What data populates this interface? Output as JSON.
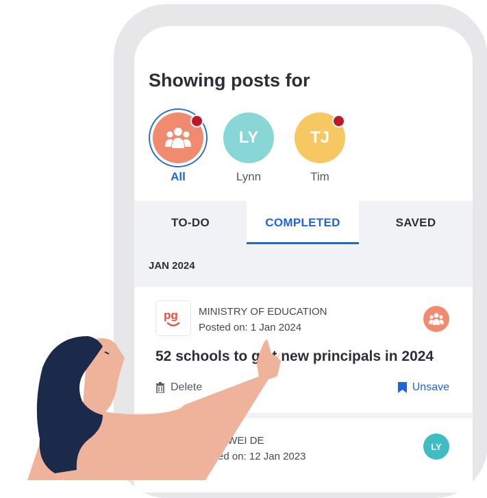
{
  "heading": "Showing posts for",
  "profiles": [
    {
      "initials": "",
      "name": "All",
      "color": "#f08b6f",
      "icon": "group-icon",
      "notify": true,
      "active": true
    },
    {
      "initials": "LY",
      "name": "Lynn",
      "color": "#88d7d6",
      "notify": false,
      "active": false
    },
    {
      "initials": "TJ",
      "name": "Tim",
      "color": "#f5c861",
      "notify": true,
      "active": false
    }
  ],
  "tabs": [
    "TO-DO",
    "COMPLETED",
    "SAVED"
  ],
  "active_tab": "COMPLETED",
  "section_label": "JAN 2024",
  "posts": [
    {
      "org": "MINISTRY OF EDUCATION",
      "posted": "Posted on: 1 Jan 2024",
      "title": "52 schools to g   t new principals in 2024",
      "logo_text": "pg",
      "badge_icon": "group-icon",
      "badge_color": "#f08b6f",
      "delete_label": "Delete",
      "unsave_label": "Unsave"
    },
    {
      "org": "E WEI DE",
      "posted": "ed on: 12 Jan 2023",
      "badge_initials": "LY",
      "badge_color": "#40bcc3"
    }
  ],
  "colors": {
    "accent": "#1f64d8",
    "notify": "#c0182a",
    "skin": "#efb39c",
    "hair": "#1b2a4a"
  }
}
